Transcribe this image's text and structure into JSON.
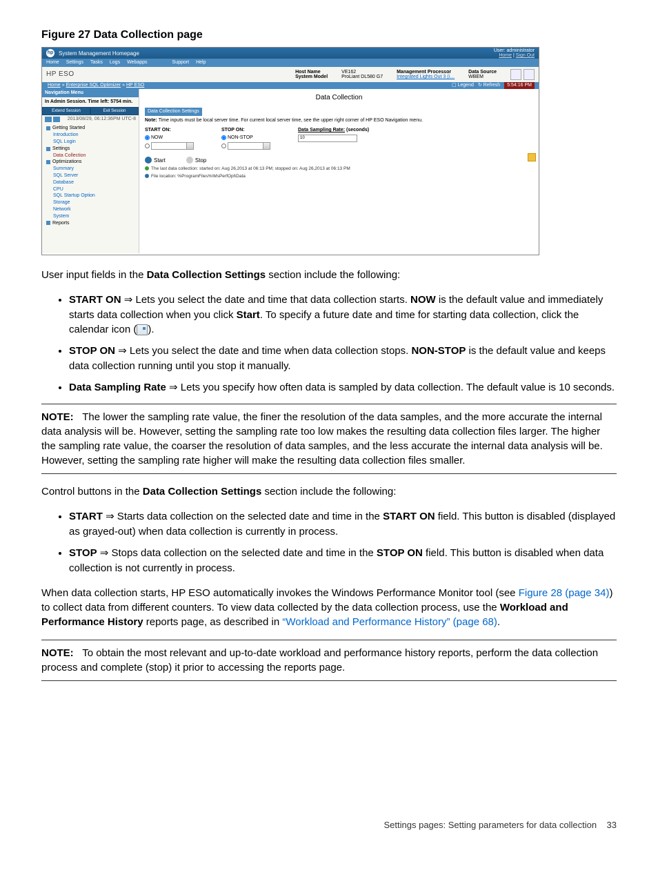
{
  "figure_title": "Figure 27 Data Collection page",
  "screenshot": {
    "app_title": "System Management Homepage",
    "user_label": "User: administrator",
    "home_link": "Home",
    "signout_link": "Sign Out",
    "menu": [
      "Home",
      "Settings",
      "Tasks",
      "Logs",
      "Webapps",
      "Support",
      "Help"
    ],
    "brand": "HP ESO",
    "host_name_label": "Host Name",
    "host_name": "VE162",
    "system_model_label": "System Model",
    "system_model": "ProLiant DL580 G7",
    "mgmt_proc_label": "Management Processor",
    "mgmt_proc": "Integrated Lights Out 3 (i…",
    "data_source_label": "Data Source",
    "data_source": "WBEM",
    "crumb_home": "Home",
    "crumb_mid": "Enterprise SQL Optimizer",
    "crumb_last": "HP ESO",
    "legend": "Legend",
    "refresh": "Refresh",
    "time_right": "5:54:16 PM",
    "nav_title": "Navigation Menu",
    "session_line": "In Admin Session.  Time left: 5754 min.",
    "extend_btn": "Extend Session",
    "exit_btn": "Exit Session",
    "timestamp": "2013/08/29, 06:12:36PM UTC-8",
    "tree": {
      "getting_started": "Getting Started",
      "introduction": "Introduction",
      "sql_login": "SQL Login",
      "settings": "Settings",
      "data_collection": "Data Collection",
      "optimizations": "Optimizations",
      "summary": "Summary",
      "sql_server": "SQL Server",
      "database": "Database",
      "cpu": "CPU",
      "sql_startup": "SQL Startup Option",
      "storage": "Storage",
      "network": "Network",
      "system": "System",
      "reports": "Reports"
    },
    "page_heading": "Data Collection",
    "box_header": "Data Collection Settings",
    "note_line": "Note: Time inputs must be local server time. For current local server time, see the upper right corner of HP ESO Navigation menu.",
    "start_on": "START ON:",
    "now": "NOW",
    "stop_on": "STOP ON:",
    "non_stop": "NON-STOP",
    "rate_label": "Data Sampling Rate:",
    "rate_unit": "(seconds)",
    "rate_value": "10",
    "start_btn": "Start",
    "stop_btn": "Stop",
    "last_collect": "The last data collection: started on: Aug 26,2013 at 06:13 PM; stopped on: Aug 26,2013 at 06:13 PM",
    "file_loc": "File location: %ProgramFiles%\\MsPerfOpt\\Data"
  },
  "para_intro": "User input fields in the ",
  "para_intro_b": "Data Collection Settings",
  "para_intro_tail": " section include the following:",
  "b1_a": "START ON",
  "b1_b": " Lets you select the date and time that data collection starts. ",
  "b1_c": "NOW",
  "b1_d": " is the default value and immediately starts data collection when you click ",
  "b1_e": "Start",
  "b1_f": ". To specify a future date and time for starting data collection, click the calendar icon (",
  "b1_g": ").",
  "b2_a": "STOP ON",
  "b2_b": " Lets you select the date and time when data collection stops. ",
  "b2_c": "NON-STOP",
  "b2_d": " is the default value and keeps data collection running until you stop it manually.",
  "b3_a": "Data Sampling Rate",
  "b3_b": " Lets you specify how often data is sampled by data collection. The default value is 10 seconds.",
  "note1_label": "NOTE:",
  "note1_body": "The lower the sampling rate value, the finer the resolution of the data samples, and the more accurate the internal data analysis will be. However, setting the sampling rate too low makes the resulting data collection files larger. The higher the sampling rate value, the coarser the resolution of data samples, and the less accurate the internal data analysis will be. However, setting the sampling rate higher will make the resulting data collection files smaller.",
  "para2": "Control buttons in the ",
  "para2_b": "Data Collection Settings",
  "para2_tail": " section include the following:",
  "b4_a": "START",
  "b4_b": " Starts data collection on the selected date and time in the ",
  "b4_c": "START ON",
  "b4_d": " field. This button is disabled (displayed as grayed-out) when data collection is currently in process.",
  "b5_a": "STOP",
  "b5_b": " Stops data collection on the selected date and time in the ",
  "b5_c": "STOP ON",
  "b5_d": " field. This button is disabled when data collection is not currently in process.",
  "para3_a": "When data collection starts, HP ESO automatically invokes the Windows Performance Monitor tool (see ",
  "para3_link1": "Figure 28 (page 34)",
  "para3_b": ") to collect data from different counters. To view data collected by the data collection process, use the ",
  "para3_bold": "Workload and Performance History",
  "para3_c": " reports page, as described in ",
  "para3_link2": "“Workload and Performance History” (page 68)",
  "para3_d": ".",
  "note2_label": "NOTE:",
  "note2_body": "To obtain the most relevant and up-to-date workload and performance history reports, perform the data collection process and complete (stop) it prior to accessing the reports page.",
  "footer_text": "Settings pages: Setting parameters for data collection",
  "footer_page": "33",
  "arrow": "⇒"
}
